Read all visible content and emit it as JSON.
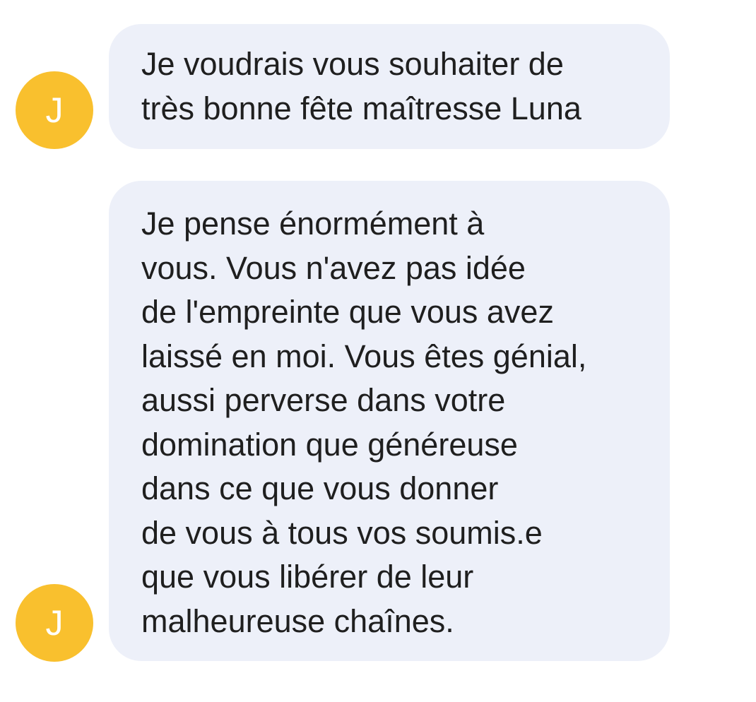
{
  "colors": {
    "avatar_background": "#f9c02e",
    "avatar_letter": "#ffffff",
    "bubble_background": "#edf0f9",
    "text": "#1f1f1f",
    "page_background": "#ffffff"
  },
  "messages": [
    {
      "sender_initial": "J",
      "lines": [
        "Je voudrais vous souhaiter de",
        "très bonne fête maîtresse Luna"
      ]
    },
    {
      "sender_initial": "J",
      "lines": [
        "Je pense énormément à",
        "vous. Vous n'avez pas idée",
        "de l'empreinte que vous avez",
        "laissé en moi. Vous êtes génial,",
        "aussi perverse dans votre",
        "domination que généreuse",
        "dans ce que vous donner",
        "de vous à tous vos soumis.e",
        "que vous libérer de leur",
        "malheureuse chaînes."
      ]
    }
  ]
}
